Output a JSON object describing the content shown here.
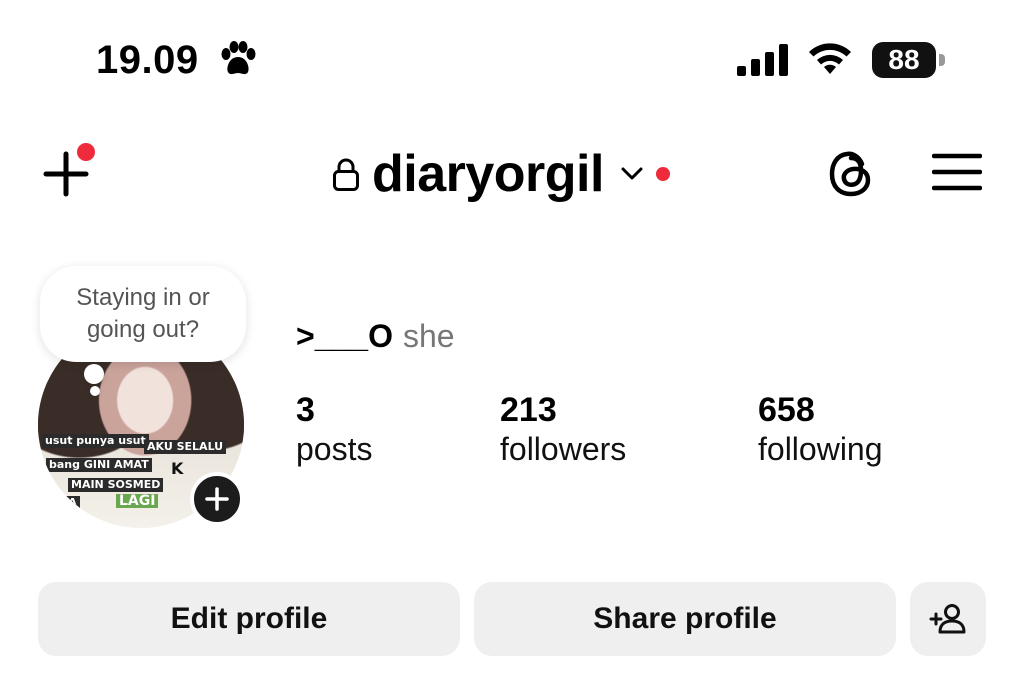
{
  "status_bar": {
    "time": "19.09",
    "battery": "88",
    "paw_icon": "paw-icon",
    "signal_icon": "cellular-signal-icon",
    "wifi_icon": "wifi-icon"
  },
  "header": {
    "username": "diaryorgil",
    "lock_icon": "lock-icon",
    "threads_icon": "threads-icon",
    "menu_icon": "hamburger-menu-icon",
    "add_icon": "plus-icon",
    "notification_color": "#ee2a3b"
  },
  "profile": {
    "note": {
      "line1": "Staying in or",
      "line2": "going out?"
    },
    "avatar_text": {
      "t1": "usut punya usut",
      "t2": "AKU SELALU",
      "t3": "bang GINI AMAT",
      "t4": "MAIN SOSMED",
      "t5": "INA",
      "t6": "LAGI",
      "t7": "K"
    },
    "display_name": ">___O",
    "pronouns": "she",
    "stats": {
      "posts": {
        "value": "3",
        "label": "posts"
      },
      "followers": {
        "value": "213",
        "label": "followers"
      },
      "following": {
        "value": "658",
        "label": "following"
      }
    }
  },
  "actions": {
    "edit_profile": "Edit profile",
    "share_profile": "Share profile",
    "add_person_icon": "add-person-icon"
  }
}
